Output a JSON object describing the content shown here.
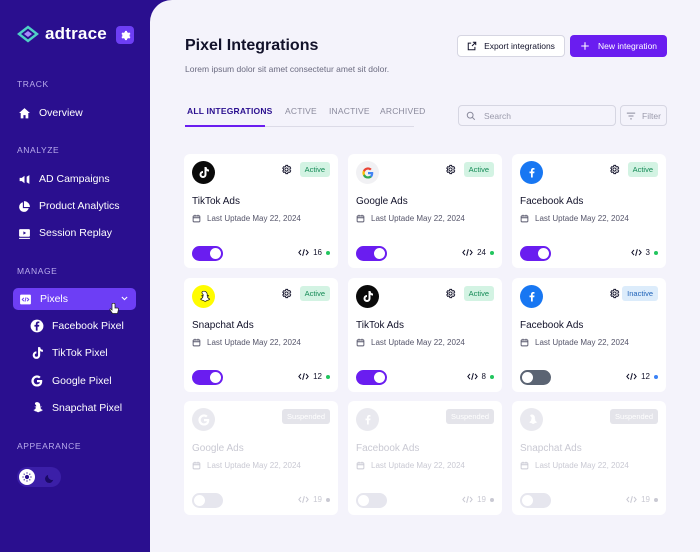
{
  "app": {
    "logo_text": "adtrace"
  },
  "sidebar": {
    "sections": {
      "track": "TRACK",
      "analyze": "ANALYZE",
      "manage": "MANAGE",
      "appearance": "APPEARANCE"
    },
    "items": {
      "overview": "Overview",
      "ad_campaigns": "AD Campaigns",
      "product_analytics": "Product Analytics",
      "session_replay": "Session Replay",
      "pixels": "Pixels"
    },
    "sub_items": [
      "Facebook Pixel",
      "TikTok Pixel",
      "Google Pixel",
      "Snapchat Pixel"
    ]
  },
  "header": {
    "title": "Pixel Integrations",
    "subtitle": "Lorem ipsum dolor sit amet consectetur amet sit dolor.",
    "export_label": "Export integrations",
    "new_label": "New integration"
  },
  "tabs": [
    "ALL INTEGRATIONS",
    "ACTIVE",
    "INACTIVE",
    "ARCHIVED"
  ],
  "search": {
    "placeholder": "Search"
  },
  "filter": {
    "label": "Filter"
  },
  "colors": {
    "accent": "#6a1df0",
    "sidebar": "#2a0f8f",
    "status_green": "#22c55e",
    "status_blue": "#3b82f6"
  },
  "cards": [
    {
      "name": "TikTok Ads",
      "brand": "tiktok-icon",
      "status": "Active",
      "date": "Last Uptade May 22, 2024",
      "toggle": "on",
      "count": "16"
    },
    {
      "name": "Google Ads",
      "brand": "google-icon",
      "status": "Active",
      "date": "Last Uptade May 22, 2024",
      "toggle": "on",
      "count": "24"
    },
    {
      "name": "Facebook Ads",
      "brand": "facebook-icon",
      "status": "Active",
      "date": "Last Uptade May 22, 2024",
      "toggle": "on",
      "count": "3"
    },
    {
      "name": "Snapchat Ads",
      "brand": "snapchat-icon",
      "status": "Active",
      "date": "Last Uptade May 22, 2024",
      "toggle": "on",
      "count": "12"
    },
    {
      "name": "TikTok Ads",
      "brand": "tiktok-icon",
      "status": "Active",
      "date": "Last Uptade May 22, 2024",
      "toggle": "on",
      "count": "8"
    },
    {
      "name": "Facebook Ads",
      "brand": "facebook-icon",
      "status": "Inactive",
      "date": "Last Uptade May 22, 2024",
      "toggle": "off",
      "count": "12"
    },
    {
      "name": "Google Ads",
      "brand": "google-icon",
      "status": "Suspended",
      "date": "Last Uptade May 22, 2024",
      "toggle": "disabled",
      "count": "19"
    },
    {
      "name": "Facebook Ads",
      "brand": "facebook-icon",
      "status": "Suspended",
      "date": "Last Uptade May 22, 2024",
      "toggle": "disabled",
      "count": "19"
    },
    {
      "name": "Snapchat Ads",
      "brand": "snapchat-icon",
      "status": "Suspended",
      "date": "Last Uptade May 22, 2024",
      "toggle": "disabled",
      "count": "19"
    }
  ]
}
